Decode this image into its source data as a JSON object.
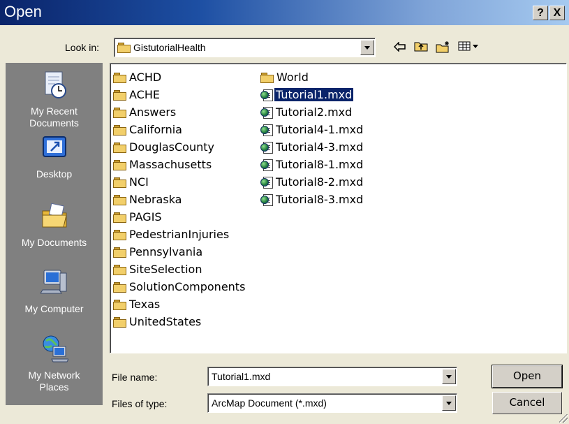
{
  "window": {
    "title": "Open",
    "help_label": "?",
    "close_label": "X"
  },
  "look_in": {
    "label": "Look in:",
    "value": "GistutorialHealth"
  },
  "toolbar": {
    "back_icon": "back-arrow-icon",
    "up_icon": "up-one-level-icon",
    "new_folder_icon": "new-folder-icon",
    "view_menu_icon": "view-menu-icon"
  },
  "places": [
    {
      "label_line1": "My Recent",
      "label_line2": "Documents",
      "icon": "recent-documents-icon"
    },
    {
      "label_line1": "Desktop",
      "label_line2": "",
      "icon": "desktop-icon"
    },
    {
      "label_line1": "My Documents",
      "label_line2": "",
      "icon": "my-documents-icon"
    },
    {
      "label_line1": "My Computer",
      "label_line2": "",
      "icon": "my-computer-icon"
    },
    {
      "label_line1": "My Network",
      "label_line2": "Places",
      "icon": "network-places-icon"
    }
  ],
  "files": {
    "column1": [
      "ACHD",
      "ACHE",
      "Answers",
      "California",
      "DouglasCounty",
      "Massachusetts",
      "NCI",
      "Nebraska",
      "PAGIS",
      "PedestrianInjuries",
      "Pennsylvania",
      "SiteSelection",
      "SolutionComponents",
      "Texas",
      "UnitedStates"
    ],
    "column2": [
      {
        "name": "World",
        "type": "folder"
      },
      {
        "name": "Tutorial1.mxd",
        "type": "mxd",
        "selected": true
      },
      {
        "name": "Tutorial2.mxd",
        "type": "mxd"
      },
      {
        "name": "Tutorial4-1.mxd",
        "type": "mxd"
      },
      {
        "name": "Tutorial4-3.mxd",
        "type": "mxd"
      },
      {
        "name": "Tutorial8-1.mxd",
        "type": "mxd"
      },
      {
        "name": "Tutorial8-2.mxd",
        "type": "mxd"
      },
      {
        "name": "Tutorial8-3.mxd",
        "type": "mxd"
      }
    ]
  },
  "file_name": {
    "label": "File name:",
    "value": "Tutorial1.mxd"
  },
  "file_type": {
    "label": "Files of type:",
    "value": "ArcMap Document (*.mxd)"
  },
  "buttons": {
    "open": "Open",
    "cancel": "Cancel"
  },
  "colors": {
    "title_bar": "#0a246a",
    "selection": "#0a246a",
    "places_bar": "#808080",
    "dialog_bg": "#ece9d8"
  }
}
